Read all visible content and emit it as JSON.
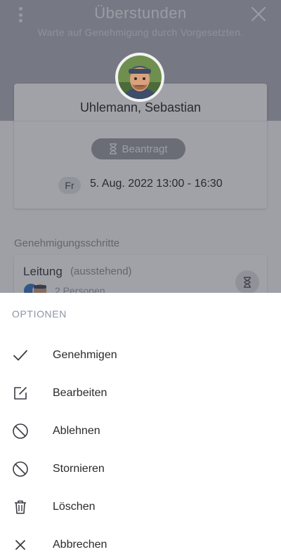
{
  "header": {
    "title": "Überstunden",
    "subtitle": "Warte auf Genehmigung durch Vorgesetzten.",
    "menu_icon": "more-vertical-icon",
    "close_icon": "close-icon"
  },
  "request": {
    "employee_name": "Uhlemann, Sebastian",
    "status": "Beantragt",
    "status_icon": "hourglass-icon",
    "day": "Fr",
    "datetime": "5. Aug. 2022 13:00 - 16:30"
  },
  "approval": {
    "section_label": "Genehmigungsschritte",
    "steps": [
      {
        "title": "Leitung",
        "status": "(ausstehend)",
        "people": "2 Personen",
        "icon": "hourglass-icon"
      }
    ]
  },
  "sheet": {
    "title": "OPTIONEN",
    "options": [
      {
        "label": "Genehmigen",
        "icon": "check-icon"
      },
      {
        "label": "Bearbeiten",
        "icon": "edit-icon"
      },
      {
        "label": "Ablehnen",
        "icon": "block-icon"
      },
      {
        "label": "Stornieren",
        "icon": "block-icon"
      },
      {
        "label": "Löschen",
        "icon": "trash-icon"
      },
      {
        "label": "Abbrechen",
        "icon": "close-icon"
      }
    ]
  },
  "colors": {
    "header_bg": "#aeb0bd",
    "overlay": "rgba(40,42,52,0.42)",
    "sheet_bg": "#ffffff",
    "sheet_title": "#8e93a6",
    "text": "#2a2a2e"
  }
}
